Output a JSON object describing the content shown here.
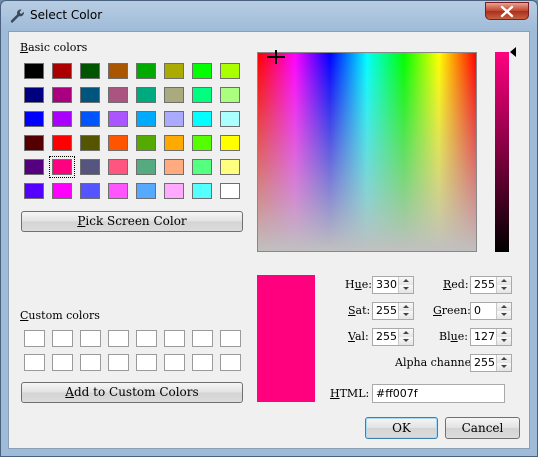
{
  "window": {
    "title": "Select Color",
    "title_icon": "wrench-icon"
  },
  "basic_colors": {
    "label_mnemonic": "B",
    "label_rest": "asic colors",
    "swatches": [
      "#000000",
      "#aa0000",
      "#005500",
      "#aa5500",
      "#00aa00",
      "#aaaa00",
      "#00ff00",
      "#aaff00",
      "#00007f",
      "#aa007f",
      "#00557f",
      "#aa557f",
      "#00aa7f",
      "#aaaa7f",
      "#00ff7f",
      "#aaff7f",
      "#0000ff",
      "#aa00ff",
      "#0055ff",
      "#aa55ff",
      "#00aaff",
      "#aaaaff",
      "#00ffff",
      "#aaffff",
      "#550000",
      "#ff0000",
      "#555500",
      "#ff5500",
      "#55aa00",
      "#ffaa00",
      "#55ff00",
      "#ffff00",
      "#55007f",
      "#ff007f",
      "#55557f",
      "#ff557f",
      "#55aa7f",
      "#ffaa7f",
      "#55ff7f",
      "#ffff7f",
      "#5500ff",
      "#ff00ff",
      "#5555ff",
      "#ff55ff",
      "#55aaff",
      "#ffaaff",
      "#55ffff",
      "#ffffff"
    ],
    "selected_index": 33
  },
  "pick_screen_button": {
    "mnemonic": "P",
    "rest": "ick Screen Color"
  },
  "custom_colors": {
    "label_mnemonic": "C",
    "label_rest": "ustom colors",
    "count": 16
  },
  "add_custom_button": {
    "mnemonic": "A",
    "rest": "dd to Custom Colors"
  },
  "current_color": "#ff007f",
  "fields": {
    "hue": {
      "mnemonic": "u",
      "pre": "H",
      "post": "e:",
      "value": "330"
    },
    "sat": {
      "mnemonic": "S",
      "pre": "",
      "post": "at:",
      "value": "255"
    },
    "val": {
      "mnemonic": "V",
      "pre": "",
      "post": "al:",
      "value": "255"
    },
    "red": {
      "mnemonic": "R",
      "pre": "",
      "post": "ed:",
      "value": "255"
    },
    "green": {
      "mnemonic": "G",
      "pre": "",
      "post": "reen:",
      "value": "0"
    },
    "blue": {
      "mnemonic": "u",
      "pre": "Bl",
      "post": "e:",
      "value": "127"
    },
    "alpha": {
      "label": "Alpha channel:",
      "value": "255"
    }
  },
  "html_field": {
    "mnemonic": "H",
    "rest": "TML:",
    "value": "#ff007f"
  },
  "buttons": {
    "ok": "OK",
    "cancel": "Cancel"
  }
}
